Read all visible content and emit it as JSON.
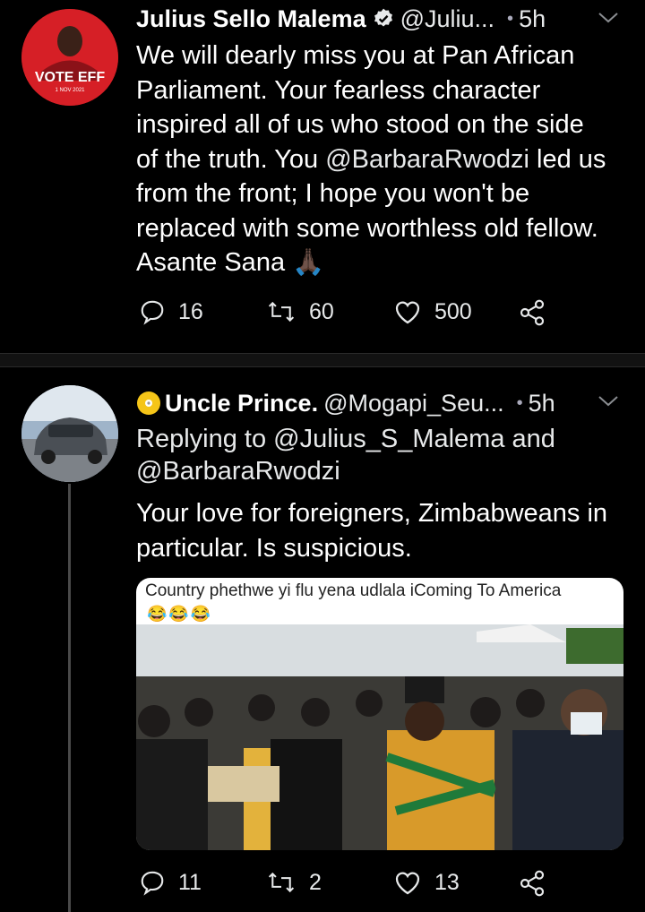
{
  "tweets": [
    {
      "name": "Julius Sello Malema",
      "handle": "@Juliu...",
      "time": "5h",
      "avatar_text": "VOTE EFF",
      "avatar_subtext": "1 NOV 2021",
      "body_pre": "We will dearly miss you at Pan African\nParliament. Your fearless character\ninspired all of us who stood on the side\nof the truth. You ",
      "body_mention": "@BarbaraRwodzi",
      "body_post": " led us\nfrom the front; I hope you won't be\nreplaced with some worthless old fellow.\nAsante Sana 🙏🏿",
      "replies": "16",
      "retweets": "60",
      "likes": "500"
    },
    {
      "name": "Uncle Prince.",
      "handle": "@Mogapi_Seu...",
      "time": "5h",
      "replying_to": "Replying to @Julius_S_Malema and\n@BarbaraRwodzi",
      "body": "Your love for foreigners, Zimbabweans in\nparticular. Is suspicious.",
      "media_caption": "Country phethwe yi flu yena udlala iComing To America",
      "media_emoji": "😂😂😂",
      "replies": "11",
      "retweets": "2",
      "likes": "13"
    }
  ],
  "icons": [
    "verified-badge-icon",
    "chevron-down-icon",
    "reply-icon",
    "retweet-icon",
    "like-icon",
    "share-icon"
  ],
  "colors": {
    "background": "#000000",
    "divider": "#121212",
    "avatar_red": "#d61f26"
  }
}
